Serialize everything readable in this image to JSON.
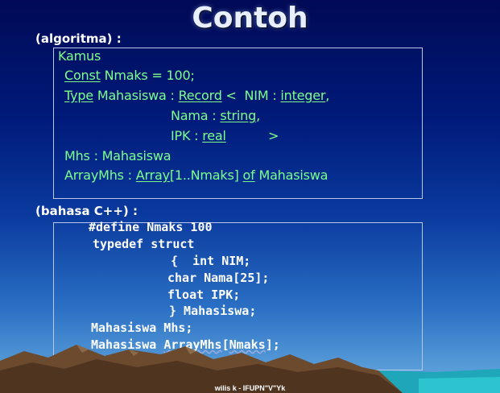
{
  "title": "Contoh",
  "algoritma": {
    "label": "(algoritma) :",
    "kamus": "Kamus",
    "const_kw": "Const",
    "const_rest": " Nmaks = 100;",
    "type_kw": "Type",
    "type_mid": " Mahasiswa : ",
    "record_kw": "Record",
    "type_after_record": " <  NIM : ",
    "integer_kw": "integer",
    "comma1": ",",
    "nama_pre": "Nama : ",
    "string_kw": "string",
    "comma2": ",",
    "ipk_pre": "IPK : ",
    "real_kw": "real",
    "close": ">",
    "mhs_line": "Mhs : Mahasiswa",
    "arr_pre": "ArrayMhs : ",
    "array_kw": "Array",
    "arr_mid": "[1..Nmaks] ",
    "of_kw": "of",
    "arr_post": " Mahasiswa"
  },
  "cpp": {
    "label": "(bahasa C++) :",
    "lines": [
      "#define Nmaks 100",
      "typedef struct",
      "{  int NIM;",
      "char Nama[25];",
      "float IPK;",
      "} Mahasiswa;",
      "Mahasiswa Mhs;"
    ],
    "last_pre": "Mahasiswa ",
    "last_arr": "ArrayMhs",
    "last_bracket": "[",
    "last_nmaks": "Nmaks",
    "last_post": "];"
  },
  "footer": "wilis k - IFUPN\"V\"Yk"
}
